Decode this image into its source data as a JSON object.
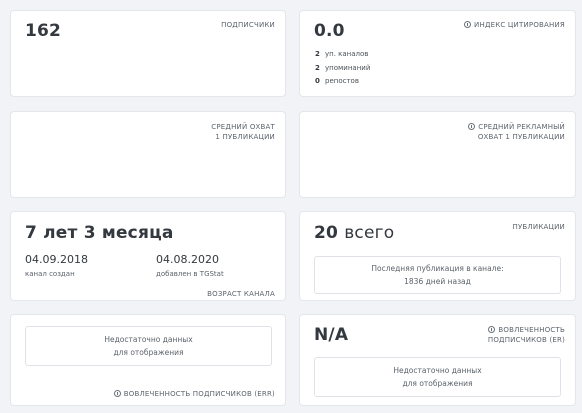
{
  "subscribers": {
    "value": "162",
    "label": "ПОДПИСЧИКИ"
  },
  "citation": {
    "value": "0.0",
    "label": "ИНДЕКС ЦИТИРОВАНИЯ",
    "rows": [
      {
        "count": "2",
        "text": "уп. каналов"
      },
      {
        "count": "2",
        "text": "упоминаний"
      },
      {
        "count": "0",
        "text": "репостов"
      }
    ]
  },
  "avg_reach": {
    "label_line1": "СРЕДНИЙ ОХВАТ",
    "label_line2": "1 ПУБЛИКАЦИИ"
  },
  "avg_ad_reach": {
    "label_line1": "СРЕДНИЙ РЕКЛАМНЫЙ",
    "label_line2": "ОХВАТ 1 ПУБЛИКАЦИИ"
  },
  "channel_age": {
    "value": "7 лет 3 месяца",
    "created_date": "04.09.2018",
    "created_label": "канал создан",
    "added_date": "04.08.2020",
    "added_label": "добавлен в TGStat",
    "label": "ВОЗРАСТ КАНАЛА"
  },
  "publications": {
    "value_num": "20",
    "value_word": "всего",
    "label": "ПУБЛИКАЦИИ",
    "last_line1": "Последняя публикация в канале:",
    "last_line2": "1836 дней назад"
  },
  "err": {
    "message_line1": "Недостаточно данных",
    "message_line2": "для отображения",
    "label": "ВОВЛЕЧЕННОСТЬ ПОДПИСЧИКОВ (ERR)"
  },
  "er": {
    "value": "N/A",
    "label_line1": "ВОВЛЕЧЕННОСТЬ",
    "label_line2": "ПОДПИСЧИКОВ (ER)",
    "message_line1": "Недостаточно данных",
    "message_line2": "для отображения"
  }
}
